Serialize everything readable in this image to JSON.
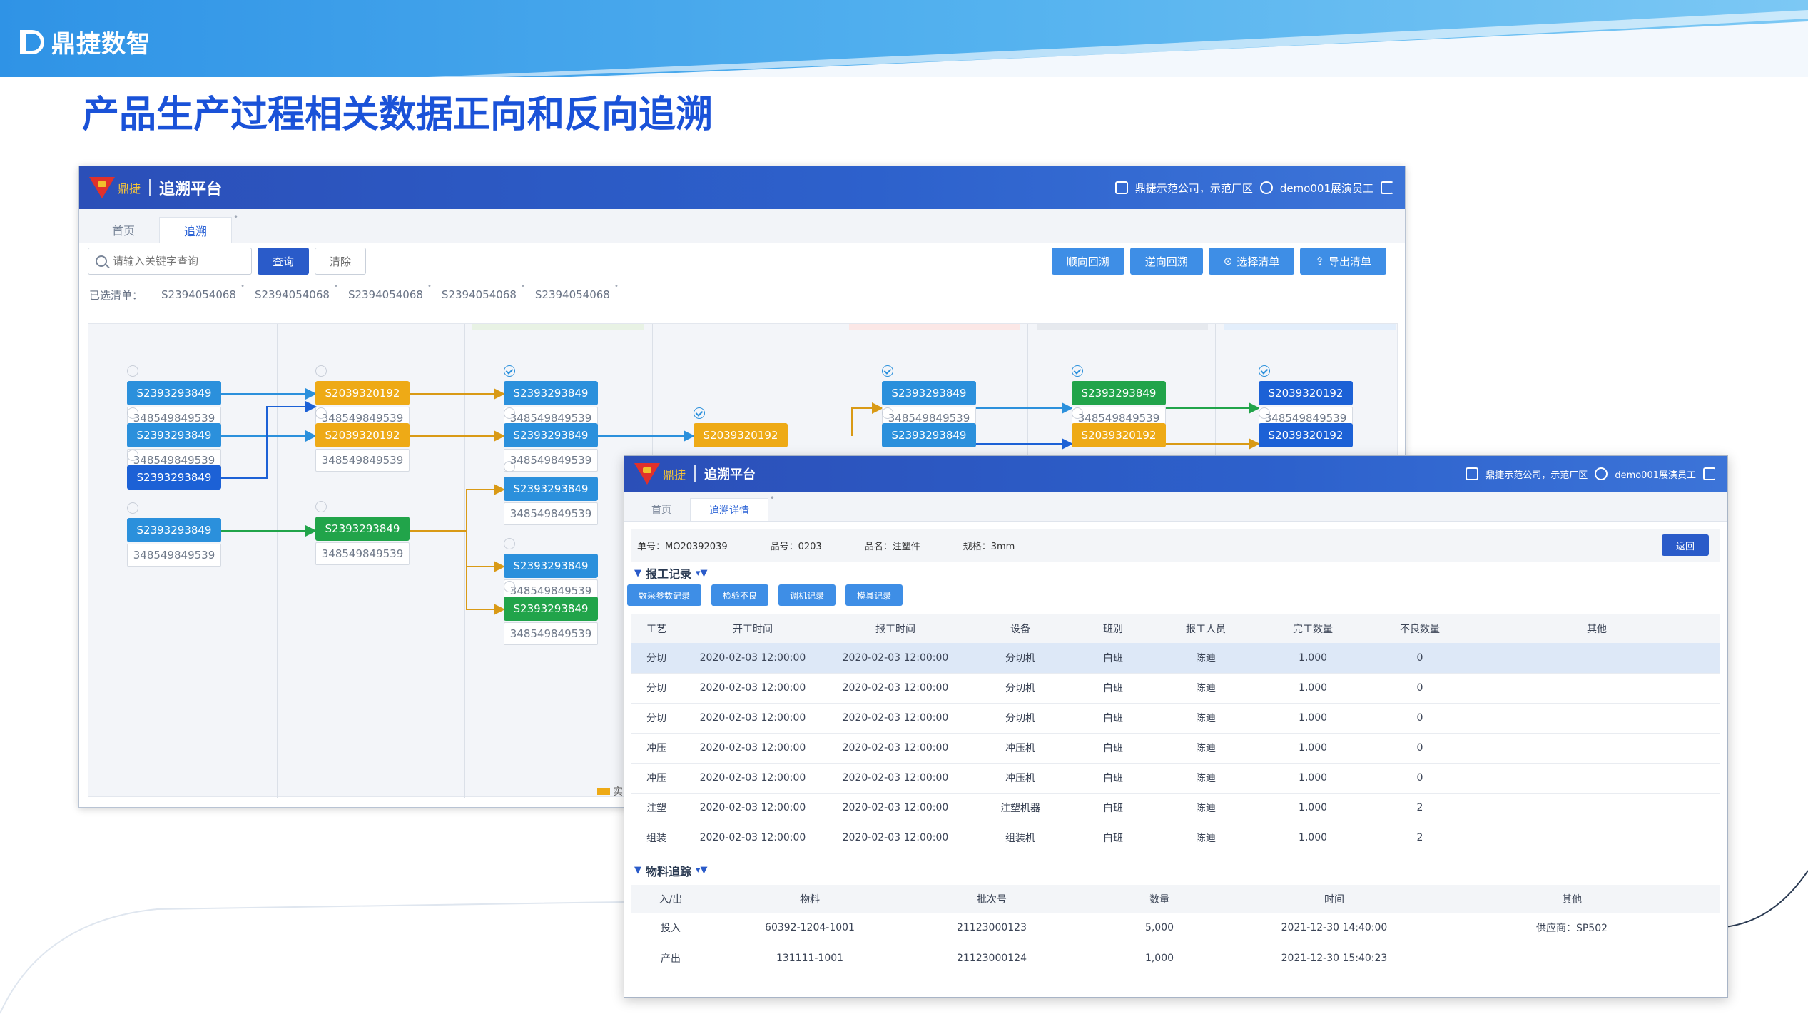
{
  "slide": {
    "brand": "鼎捷数智",
    "title": "产品生产过程相关数据正向和反向追溯"
  },
  "colors": {
    "primary": "#2a5bc9",
    "topbar": "#2d61cc",
    "node_blue": "#2b90dc",
    "node_dark_blue": "#1c61d6",
    "node_orange": "#eeaa16",
    "node_green": "#21a44a"
  },
  "app": {
    "title": "追溯平台",
    "logo_text": "鼎捷",
    "company": "鼎捷示范公司，示范厂区",
    "user": "demo001展演员工"
  },
  "win1": {
    "tabs": [
      "首页",
      "追溯"
    ],
    "search_placeholder": "请输入关键字查询",
    "query_label": "查询",
    "clear_label": "清除",
    "actions": [
      "顺向回溯",
      "逆向回溯",
      "选择清单",
      "导出清单"
    ],
    "selected_label": "已选清单：",
    "selected_items": [
      "S2394054068",
      "S2394054068",
      "S2394054068",
      "S2394054068",
      "S2394054068"
    ],
    "legend_label": "实",
    "nodes": [
      {
        "code": "S2393293849",
        "sub": "348549849539",
        "color": "c-blue",
        "checked": false
      },
      {
        "code": "S2393293849",
        "sub": "348549849539",
        "color": "c-blue",
        "checked": false
      },
      {
        "code": "S2393293849",
        "sub": "",
        "color": "c-dblue",
        "checked": false
      },
      {
        "code": "S2393293849",
        "sub": "348549849539",
        "color": "c-blue",
        "checked": false
      },
      {
        "code": "S2039320192",
        "sub": "348549849539",
        "color": "c-orange",
        "checked": false
      },
      {
        "code": "S2039320192",
        "sub": "348549849539",
        "color": "c-orange",
        "checked": false
      },
      {
        "code": "S2393293849",
        "sub": "348549849539",
        "color": "c-green",
        "checked": false
      },
      {
        "code": "S2393293849",
        "sub": "348549849539",
        "color": "c-blue",
        "checked": true
      },
      {
        "code": "S2393293849",
        "sub": "348549849539",
        "color": "c-blue",
        "checked": false
      },
      {
        "code": "S2393293849",
        "sub": "348549849539",
        "color": "c-blue",
        "checked": false
      },
      {
        "code": "S2393293849",
        "sub": "348549849539",
        "color": "c-blue",
        "checked": false
      },
      {
        "code": "S2393293849",
        "sub": "348549849539",
        "color": "c-green",
        "checked": false
      },
      {
        "code": "S2039320192",
        "sub": "",
        "color": "c-orange",
        "checked": true
      },
      {
        "code": "S2393293849",
        "sub": "348549849539",
        "color": "c-blue",
        "checked": true
      },
      {
        "code": "S2393293849",
        "sub": "",
        "color": "c-blue",
        "checked": false
      },
      {
        "code": "S2393293849",
        "sub": "348549849539",
        "color": "c-green",
        "checked": true
      },
      {
        "code": "S2039320192",
        "sub": "",
        "color": "c-orange",
        "checked": false
      },
      {
        "code": "S2039320192",
        "sub": "348549849539",
        "color": "c-dblue",
        "checked": true
      },
      {
        "code": "S2039320192",
        "sub": "",
        "color": "c-dblue",
        "checked": false
      }
    ]
  },
  "win2": {
    "tabs": [
      "首页",
      "追溯详情"
    ],
    "info": {
      "order": "单号：MO20392039",
      "item_no": "品号：0203",
      "item_name": "品名：注塑件",
      "spec": "规格：3mm"
    },
    "back_label": "返回",
    "report_title": "报工记录",
    "report_buttons": [
      "数采参数记录",
      "检验不良",
      "调机记录",
      "模具记录"
    ],
    "report_headers": [
      "工艺",
      "开工时间",
      "报工时间",
      "设备",
      "班别",
      "报工人员",
      "完工数量",
      "不良数量",
      "其他"
    ],
    "report_rows": [
      [
        "分切",
        "2020-02-03 12:00:00",
        "2020-02-03 12:00:00",
        "分切机",
        "白班",
        "陈迪",
        "1,000",
        "0",
        ""
      ],
      [
        "分切",
        "2020-02-03 12:00:00",
        "2020-02-03 12:00:00",
        "分切机",
        "白班",
        "陈迪",
        "1,000",
        "0",
        ""
      ],
      [
        "分切",
        "2020-02-03 12:00:00",
        "2020-02-03 12:00:00",
        "分切机",
        "白班",
        "陈迪",
        "1,000",
        "0",
        ""
      ],
      [
        "冲压",
        "2020-02-03 12:00:00",
        "2020-02-03 12:00:00",
        "冲压机",
        "白班",
        "陈迪",
        "1,000",
        "0",
        ""
      ],
      [
        "冲压",
        "2020-02-03 12:00:00",
        "2020-02-03 12:00:00",
        "冲压机",
        "白班",
        "陈迪",
        "1,000",
        "0",
        ""
      ],
      [
        "注塑",
        "2020-02-03 12:00:00",
        "2020-02-03 12:00:00",
        "注塑机器",
        "白班",
        "陈迪",
        "1,000",
        "2",
        ""
      ],
      [
        "组装",
        "2020-02-03 12:00:00",
        "2020-02-03 12:00:00",
        "组装机",
        "白班",
        "陈迪",
        "1,000",
        "2",
        ""
      ]
    ],
    "material_title": "物料追踪",
    "material_headers": [
      "入/出",
      "物料",
      "批次号",
      "数量",
      "时间",
      "其他"
    ],
    "material_rows": [
      [
        "投入",
        "60392-1204-1001",
        "21123000123",
        "5,000",
        "2021-12-30 14:40:00",
        "供应商：SP502"
      ],
      [
        "产出",
        "131111-1001",
        "21123000124",
        "1,000",
        "2021-12-30 15:40:23",
        ""
      ]
    ]
  }
}
